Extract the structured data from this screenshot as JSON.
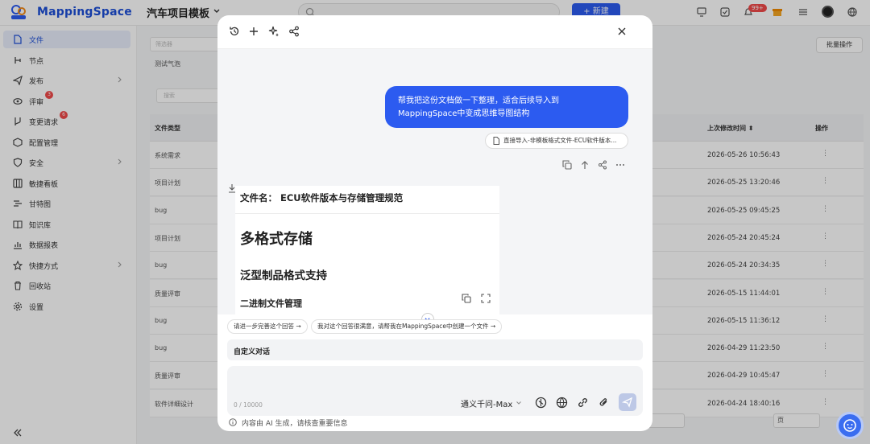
{
  "header": {
    "logo_text": "MappingSpace",
    "project_title": "汽车项目模板",
    "new_button": "+ 新建",
    "notif_badge": "99+"
  },
  "sidebar": {
    "items": [
      {
        "label": "文件",
        "icon": "file-icon",
        "active": true
      },
      {
        "label": "节点",
        "icon": "node-icon"
      },
      {
        "label": "发布",
        "icon": "send-icon",
        "arrow": true
      },
      {
        "label": "评审",
        "icon": "eye-icon",
        "badge": "3"
      },
      {
        "label": "变更请求",
        "icon": "branch-icon",
        "badge": "6"
      },
      {
        "label": "配置管理",
        "icon": "package-icon"
      },
      {
        "label": "安全",
        "icon": "shield-icon",
        "arrow": true
      },
      {
        "label": "敏捷看板",
        "icon": "kanban-icon"
      },
      {
        "label": "甘特图",
        "icon": "gantt-icon"
      },
      {
        "label": "知识库",
        "icon": "book-icon"
      },
      {
        "label": "数据报表",
        "icon": "chart-icon"
      },
      {
        "label": "快捷方式",
        "icon": "star-icon",
        "arrow": true
      },
      {
        "label": "回收站",
        "icon": "trash-icon"
      },
      {
        "label": "设置",
        "icon": "settings-icon"
      }
    ]
  },
  "background": {
    "filter_placeholder": "筛选器",
    "tag": "测试气泡",
    "search_placeholder": "搜索",
    "batch_button": "批量操作",
    "columns": {
      "type": "文件类型",
      "modified": "上次修改时间 ⬍",
      "action": "操作"
    },
    "rows": [
      {
        "type": "系统需求",
        "date": "2026-05-26 10:56:43"
      },
      {
        "type": "项目计划",
        "date": "2026-05-25 13:20:46"
      },
      {
        "type": "bug",
        "date": "2026-05-25 09:45:25"
      },
      {
        "type": "项目计划",
        "date": "2026-05-24 20:45:24"
      },
      {
        "type": "bug",
        "date": "2026-05-24 20:34:35"
      },
      {
        "type": "质量评审",
        "date": "2026-05-15 11:44:01"
      },
      {
        "type": "bug",
        "date": "2026-05-15 11:36:12"
      },
      {
        "type": "bug",
        "date": "2026-04-29 11:23:50"
      },
      {
        "type": "质量评审",
        "date": "2026-04-29 10:45:47"
      },
      {
        "type": "软件详细设计",
        "date": "2026-04-24 18:40:16"
      }
    ],
    "pager_text": "页"
  },
  "dialog": {
    "user_message": "帮我把这份文档做一下整理，适合后续导入到MappingSpace中变成思维导图结构",
    "attachment": "直接导入-非模板格式文件-ECU软件版本...",
    "doc": {
      "filename": "文件名： ECU软件版本与存储管理规范",
      "h1": "多格式存储",
      "h2": "泛型制品格式支持",
      "h3": "二进制文件管理"
    },
    "suggestions": [
      "请进一步完善这个回答 →",
      "我对这个回答很满意，请帮我在MappingSpace中创建一个文件 →"
    ],
    "custom_label": "自定义对话",
    "counter": "0 / 10000",
    "model": "通义千问-Max",
    "footer": "内容由 AI 生成，请核查重要信息"
  },
  "colors": {
    "accent": "#2c5bf0",
    "brand": "#1d4fd8"
  }
}
